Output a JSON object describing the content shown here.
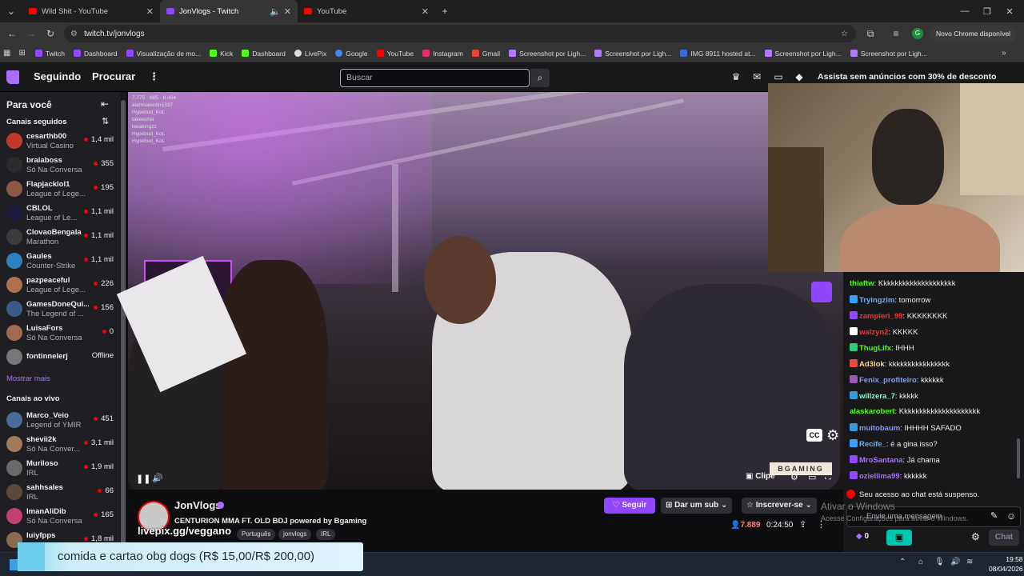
{
  "browser": {
    "tabs": [
      {
        "title": "Wild Shit - YouTube",
        "favicon_color": "#ff0000",
        "active": false
      },
      {
        "title": "JonVlogs - Twitch",
        "favicon_color": "#9146ff",
        "active": true
      },
      {
        "title": "YouTube",
        "favicon_color": "#ff0000",
        "active": false
      }
    ],
    "new_tab_label": "+",
    "url": "twitch.tv/jonvlogs",
    "update_button": "Novo Chrome disponível",
    "profile_initial": "G",
    "bookmarks": [
      {
        "label": "Twitch",
        "color": "#9146ff"
      },
      {
        "label": "Dashboard",
        "color": "#9146ff"
      },
      {
        "label": "Visualização de mo...",
        "color": "#9146ff"
      },
      {
        "label": "Kick",
        "color": "#53fc18"
      },
      {
        "label": "Dashboard",
        "color": "#53fc18"
      },
      {
        "label": "LivePix",
        "color": "#dddddd"
      },
      {
        "label": "Google",
        "color": "#4285f4"
      },
      {
        "label": "YouTube",
        "color": "#ff0000"
      },
      {
        "label": "Instagram",
        "color": "#e1306c"
      },
      {
        "label": "Gmail",
        "color": "#ea4335"
      },
      {
        "label": "Screenshot por Ligh...",
        "color": "#b678ff"
      },
      {
        "label": "Screenshot por Ligh...",
        "color": "#b678ff"
      },
      {
        "label": "IMG 8911 hosted at...",
        "color": "#3b6ad6"
      },
      {
        "label": "Screenshot por Ligh...",
        "color": "#b678ff"
      },
      {
        "label": "Screenshot por Ligh...",
        "color": "#b678ff"
      }
    ]
  },
  "twitch": {
    "nav": {
      "following": "Seguindo",
      "browse": "Procurar",
      "search_placeholder": "Buscar",
      "promo": "Assista sem anúncios com 30% de desconto"
    },
    "sidebar": {
      "title": "Para você",
      "followed_header": "Canais seguidos",
      "followed": [
        {
          "name": "cesarthb00",
          "game": "Virtual Casino",
          "viewers": "1,4 mil",
          "color": "#c0392b"
        },
        {
          "name": "braiaboss",
          "game": "Só Na Conversa",
          "viewers": "355",
          "color": "#2c2c2c"
        },
        {
          "name": "Flapjacklol1",
          "game": "League of Lege...",
          "viewers": "195",
          "color": "#8a5a44"
        },
        {
          "name": "CBLOL",
          "game": "League of Le...",
          "viewers": "1,1 mil",
          "color": "#1b1b3a"
        },
        {
          "name": "ClovaoBengala",
          "game": "Marathon",
          "viewers": "1,1 mil",
          "color": "#3d3d3d"
        },
        {
          "name": "Gaules",
          "game": "Counter-Strike",
          "viewers": "1,1 mil",
          "color": "#2f80c0"
        },
        {
          "name": "pazpeaceful",
          "game": "League of Lege...",
          "viewers": "226",
          "color": "#b0704a"
        },
        {
          "name": "GamesDoneQui...",
          "game": "The Legend of ...",
          "viewers": "156",
          "color": "#3a5a8a"
        },
        {
          "name": "LuisaFors",
          "game": "Só Na Conversa",
          "viewers": "0",
          "color": "#a06a50"
        },
        {
          "name": "fontinnelerj",
          "game": "",
          "viewers": "Offline",
          "color": "#777777"
        }
      ],
      "show_more": "Mostrar mais",
      "live_header": "Canais ao vivo",
      "live": [
        {
          "name": "Marco_Veio",
          "game": "Legend of YMIR",
          "viewers": "451",
          "color": "#4a6a9a"
        },
        {
          "name": "shevii2k",
          "game": "Só Na Conver...",
          "viewers": "3,1 mil",
          "color": "#a07a5a"
        },
        {
          "name": "Muriloso",
          "game": "IRL",
          "viewers": "1,9 mil",
          "color": "#6a6a6a"
        },
        {
          "name": "sahhsales",
          "game": "IRL",
          "viewers": "66",
          "color": "#5a4a3a"
        },
        {
          "name": "ImanAliDib",
          "game": "Só Na Conversa",
          "viewers": "165",
          "color": "#c04070"
        },
        {
          "name": "luiyfpps",
          "game": "",
          "viewers": "1,8 mil",
          "color": "#8a6a4a"
        }
      ]
    },
    "video": {
      "overlay_stats": [
        "7.775",
        "685",
        "8.464"
      ],
      "overlay_users": [
        "aiamvalentin1337",
        "Hypebud_KoL",
        "takeeshiii",
        "leeakingzz",
        "Hypebud_KoL",
        "Hypebud_KoL"
      ],
      "sponsor_badge": "BGAMING",
      "clip_label": "Clipe",
      "cc_label": "CC"
    },
    "channel": {
      "name": "JonVlogs",
      "title": "CENTURION MMA FT. OLD BDJ powered by Bgaming",
      "tags": [
        "Português",
        "jonvlogs",
        "IRL"
      ],
      "livepix_overlay": "livepix.gg/veggano",
      "follow": "Seguir",
      "gift_sub": "Dar um sub",
      "subscribe": "Inscrever-se",
      "viewers": "7.889",
      "uptime": "0:24:50"
    },
    "chat": {
      "messages": [
        {
          "user": "thiaftw",
          "text": "Kkkkkkkkkkkkkkkkkkkk",
          "color": "#53fc18",
          "badge": ""
        },
        {
          "user": "Tryingzim",
          "text": "tomorrow",
          "color": "#5eb3ff",
          "badge": "#3aa0ff"
        },
        {
          "user": "zampieri_99",
          "text": "KKKKKKKK",
          "color": "#ff2e2e",
          "badge": "#9146ff"
        },
        {
          "user": "walzyn2",
          "text": "KKKKK",
          "color": "#ff2e2e",
          "badge": "#ffffff"
        },
        {
          "user": "ThugLifx",
          "text": "IHHH",
          "color": "#53fc18",
          "badge": "#2ecc71"
        },
        {
          "user": "Ad3lok",
          "text": "kkkkkkkkkkkkkkkk",
          "color": "#ffd37a",
          "badge": "#e74c3c"
        },
        {
          "user": "Fenix_profiteiro",
          "text": "kkkkkk",
          "color": "#7f9cff",
          "badge": "#9b59b6"
        },
        {
          "user": "willzera_7",
          "text": "kkkkk",
          "color": "#7fffd4",
          "badge": "#3498db"
        },
        {
          "user": "alaskarobert",
          "text": "Kkkkkkkkkkkkkkkkkkkkk",
          "color": "#53fc18",
          "badge": ""
        },
        {
          "user": "muitobaum",
          "text": "IHHHH SAFADO",
          "color": "#7f9cff",
          "badge": "#3498db"
        },
        {
          "user": "Recife_",
          "text": "é a gina isso?",
          "color": "#5eb3ff",
          "badge": "#3aa0ff"
        },
        {
          "user": "MroSantana",
          "text": "Já chama",
          "color": "#a970ff",
          "badge": "#9146ff"
        },
        {
          "user": "ozieliima99",
          "text": "kkkkkk",
          "color": "#a970ff",
          "badge": "#9146ff"
        }
      ],
      "suspended": "Seu acesso ao chat está suspenso.",
      "input_placeholder": "Envie uma mensagem",
      "bits": "0",
      "chat_button": "Chat"
    }
  },
  "windows": {
    "activate_title": "Ativar o Windows",
    "activate_sub": "Acesse Configurações para ativar o Windows.",
    "time": "19:58",
    "date": "08/04/2026"
  },
  "alert": {
    "text": "comida e cartao obg dogs (R$ 15,00/R$ 200,00)"
  }
}
